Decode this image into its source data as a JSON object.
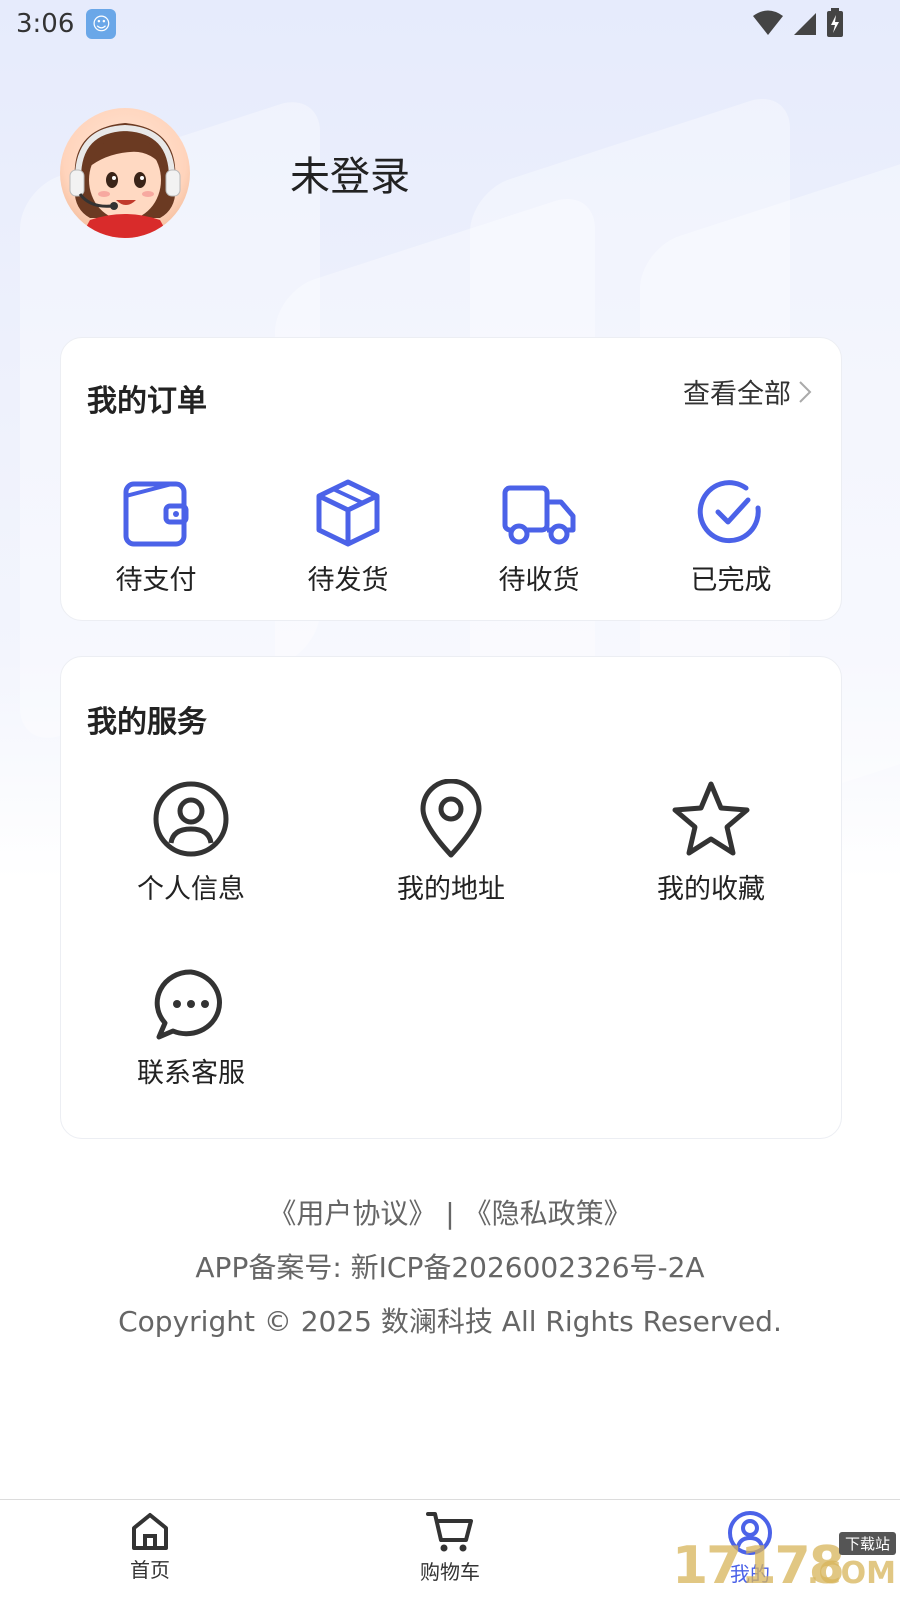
{
  "status_bar": {
    "time": "3:06"
  },
  "profile": {
    "username": "未登录"
  },
  "orders": {
    "title": "我的订单",
    "view_all": "查看全部",
    "items": [
      {
        "label": "待支付",
        "icon": "wallet-icon"
      },
      {
        "label": "待发货",
        "icon": "package-icon"
      },
      {
        "label": "待收货",
        "icon": "truck-icon"
      },
      {
        "label": "已完成",
        "icon": "check-circle-icon"
      }
    ]
  },
  "services": {
    "title": "我的服务",
    "items": [
      {
        "label": "个人信息",
        "icon": "user-circle-icon"
      },
      {
        "label": "我的地址",
        "icon": "location-pin-icon"
      },
      {
        "label": "我的收藏",
        "icon": "star-icon"
      },
      {
        "label": "联系客服",
        "icon": "chat-bubble-icon"
      }
    ]
  },
  "footer": {
    "agreements": "《用户协议》 | 《隐私政策》",
    "icp": "APP备案号: 新ICP备2026002326号-2A",
    "copyright": "Copyright © 2025 数澜科技 All Rights Reserved."
  },
  "tabbar": {
    "tabs": [
      {
        "label": "首页",
        "icon": "home-icon",
        "active": false
      },
      {
        "label": "购物车",
        "icon": "cart-icon",
        "active": false
      },
      {
        "label": "我的",
        "icon": "user-icon",
        "active": true
      }
    ]
  },
  "watermark": {
    "text": "17178",
    "suffix": "下载站",
    "domain": ".COM"
  },
  "colors": {
    "accent": "#4b62e8",
    "icon_dark": "#333333"
  }
}
